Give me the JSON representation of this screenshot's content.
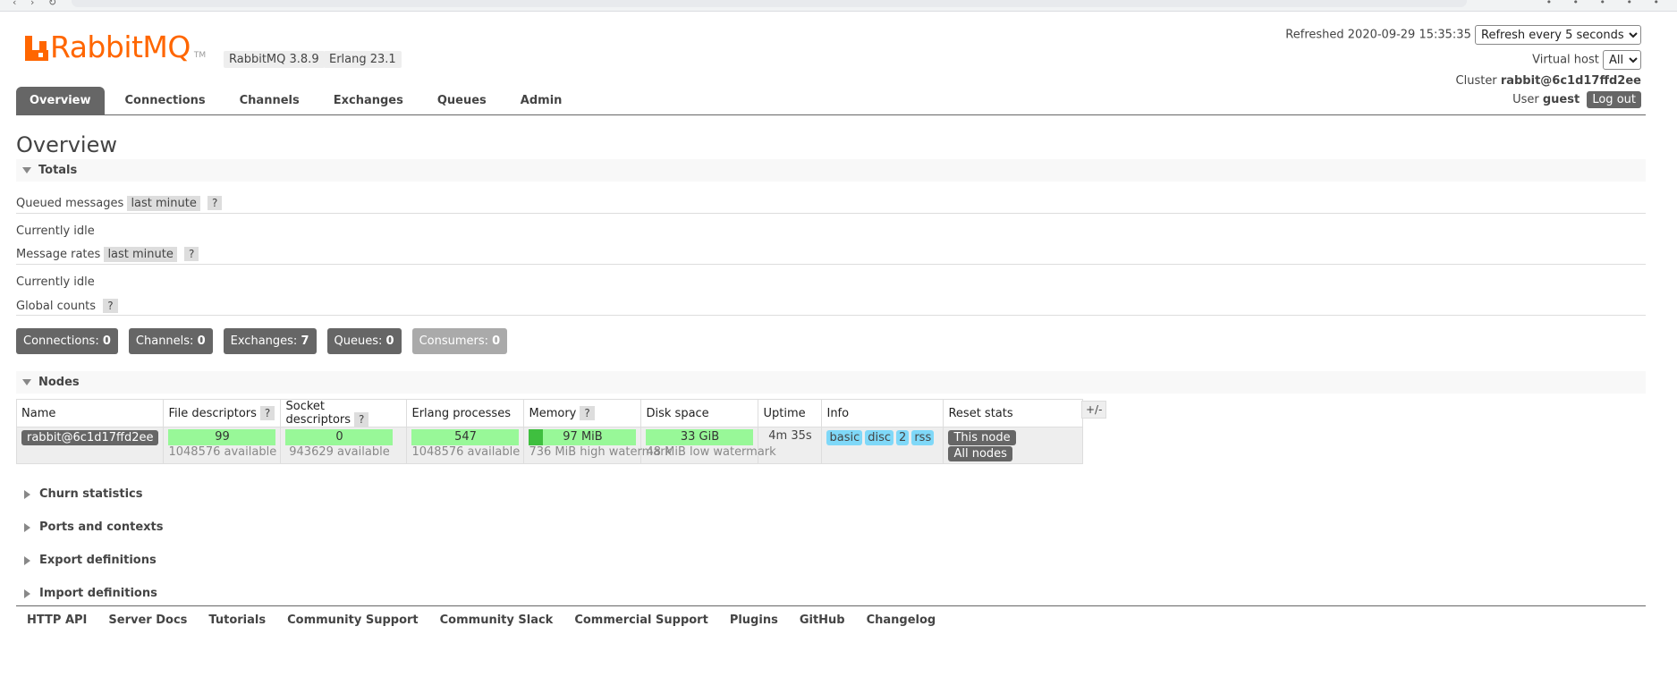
{
  "app": {
    "name": "RabbitMQ",
    "tm": "TM",
    "version": "RabbitMQ 3.8.9",
    "erlang": "Erlang 23.1"
  },
  "header": {
    "refreshed_label": "Refreshed",
    "refreshed_time": "2020-09-29 15:35:35",
    "refresh_option": "Refresh every 5 seconds",
    "vhost_label": "Virtual host",
    "vhost_value": "All",
    "cluster_label": "Cluster",
    "cluster_value": "rabbit@6c1d17ffd2ee",
    "user_label": "User",
    "user_value": "guest",
    "logout_label": "Log out"
  },
  "tabs": [
    {
      "label": "Overview"
    },
    {
      "label": "Connections"
    },
    {
      "label": "Channels"
    },
    {
      "label": "Exchanges"
    },
    {
      "label": "Queues"
    },
    {
      "label": "Admin"
    }
  ],
  "page_title": "Overview",
  "totals": {
    "title": "Totals",
    "queued_label": "Queued messages",
    "queued_range": "last minute",
    "help": "?",
    "queued_idle": "Currently idle",
    "rates_label": "Message rates",
    "rates_range": "last minute",
    "rates_idle": "Currently idle",
    "global_label": "Global counts"
  },
  "counts": [
    {
      "label": "Connections:",
      "value": "0"
    },
    {
      "label": "Channels:",
      "value": "0"
    },
    {
      "label": "Exchanges:",
      "value": "7"
    },
    {
      "label": "Queues:",
      "value": "0"
    },
    {
      "label": "Consumers:",
      "value": "0"
    }
  ],
  "nodes": {
    "title": "Nodes",
    "columns": [
      "Name",
      "File descriptors",
      "Socket descriptors",
      "Erlang processes",
      "Memory",
      "Disk space",
      "Uptime",
      "Info",
      "Reset stats"
    ],
    "plus_minus": "+/-",
    "row": {
      "name": "rabbit@6c1d17ffd2ee",
      "fd_value": "99",
      "fd_available": "1048576 available",
      "sd_value": "0",
      "sd_available": "943629 available",
      "erl_value": "547",
      "erl_available": "1048576 available",
      "mem_value": "97 MiB",
      "mem_fraction": 0.13,
      "mem_watermark": "736 MiB high watermark",
      "disk_value": "33 GiB",
      "disk_watermark": "48 MiB low watermark",
      "uptime": "4m 35s",
      "info": [
        "basic",
        "disc",
        "2",
        "rss"
      ],
      "reset_this": "This node",
      "reset_all": "All nodes"
    }
  },
  "sections": [
    {
      "label": "Churn statistics"
    },
    {
      "label": "Ports and contexts"
    },
    {
      "label": "Export definitions"
    },
    {
      "label": "Import definitions"
    }
  ],
  "footer": [
    "HTTP API",
    "Server Docs",
    "Tutorials",
    "Community Support",
    "Community Slack",
    "Commercial Support",
    "Plugins",
    "GitHub",
    "Changelog"
  ]
}
